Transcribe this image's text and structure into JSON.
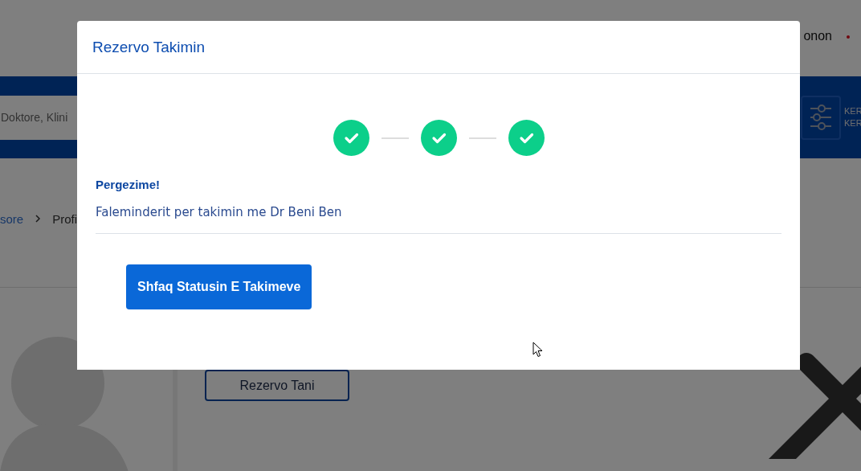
{
  "page": {
    "header_link": "onon",
    "search": {
      "placeholder": "Doktore, Klini"
    },
    "filter_labels": [
      "KER",
      "KER"
    ],
    "breadcrumb": [
      "sore",
      "Profi"
    ],
    "book_button": "Rezervo Tani"
  },
  "modal": {
    "title": "Rezervo Takimin",
    "steps": [
      {
        "done": true
      },
      {
        "done": true
      },
      {
        "done": true
      }
    ],
    "heading": "Pergezime!",
    "message": "Faleminderit per takimin me Dr Beni Ben",
    "button": "Shfaq Statusin E Takimeve"
  }
}
